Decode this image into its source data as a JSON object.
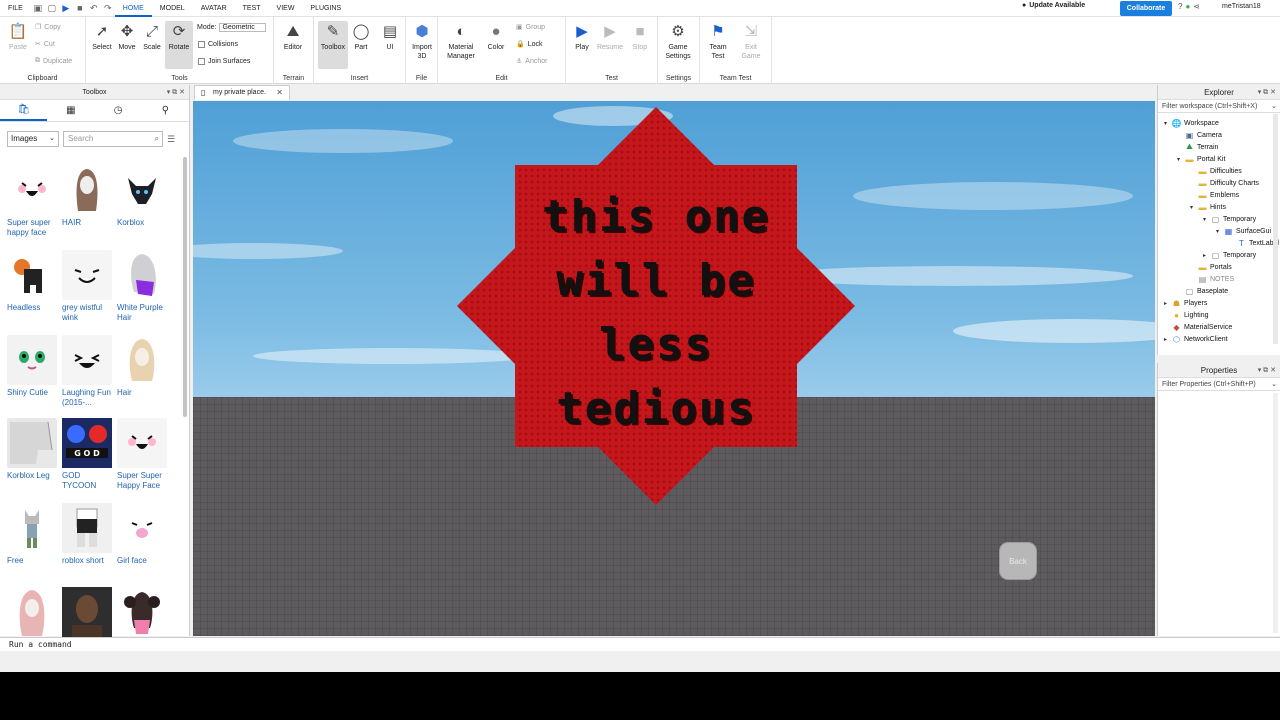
{
  "menubar": {
    "items": [
      "FILE",
      "HOME",
      "MODEL",
      "AVATAR",
      "TEST",
      "VIEW",
      "PLUGINS"
    ],
    "active": "HOME",
    "update_label": "Update Available",
    "collab_label": "Collaborate",
    "username": "meTristan18"
  },
  "ribbon": {
    "clipboard": {
      "paste": "Paste",
      "copy": "Copy",
      "cut": "Cut",
      "duplicate": "Duplicate",
      "label": "Clipboard"
    },
    "tools": {
      "select": "Select",
      "move": "Move",
      "scale": "Scale",
      "rotate": "Rotate",
      "mode_label": "Mode:",
      "mode_value": "Geometric",
      "collisions": "Collisions",
      "join_surfaces": "Join Surfaces",
      "label": "Tools"
    },
    "terrain": {
      "editor": "Editor",
      "label": "Terrain"
    },
    "insert": {
      "toolbox": "Toolbox",
      "part": "Part",
      "ui": "UI",
      "label": "Insert"
    },
    "file": {
      "import3d_l1": "Import",
      "import3d_l2": "3D",
      "label": "File"
    },
    "edit": {
      "material_l1": "Material",
      "material_l2": "Manager",
      "color": "Color",
      "group": "Group",
      "lock": "Lock",
      "anchor": "Anchor",
      "label": "Edit"
    },
    "test": {
      "play": "Play",
      "resume": "Resume",
      "stop": "Stop",
      "label": "Test"
    },
    "settings": {
      "game_l1": "Game",
      "game_l2": "Settings",
      "label": "Settings"
    },
    "teamtest": {
      "team_l1": "Team",
      "team_l2": "Test",
      "exit_l1": "Exit",
      "exit_l2": "Game",
      "label": "Team Test"
    }
  },
  "toolbox": {
    "title": "Toolbox",
    "category": "Images",
    "search_placeholder": "Search",
    "items": [
      {
        "label": "Super super happy face"
      },
      {
        "label": "HAIR"
      },
      {
        "label": "Korblox"
      },
      {
        "label": "Headless"
      },
      {
        "label": "grey wistful wink"
      },
      {
        "label": "White Purple Hair"
      },
      {
        "label": "Shiny Cutie"
      },
      {
        "label": "Laughing Fun (2015-..."
      },
      {
        "label": "Hair"
      },
      {
        "label": "Korblox Leg"
      },
      {
        "label": "GOD TYCOON"
      },
      {
        "label": "Super Super Happy Face"
      },
      {
        "label": "Free"
      },
      {
        "label": "roblox short"
      },
      {
        "label": "Girl face"
      },
      {
        "label": ""
      },
      {
        "label": ""
      },
      {
        "label": ""
      }
    ]
  },
  "document_tab": "my private place.",
  "viewport": {
    "sign_lines": [
      "this one",
      "will be",
      "less",
      "tedious"
    ],
    "sign_color": "#c4161c",
    "back_button": "Back"
  },
  "command_bar": "Run a command",
  "explorer": {
    "title": "Explorer",
    "filter": "Filter workspace (Ctrl+Shift+X)",
    "rows": [
      {
        "label": "Workspace",
        "depth": 0,
        "tw": "▾",
        "icon": "globe-icon"
      },
      {
        "label": "Camera",
        "depth": 1,
        "tw": "",
        "icon": "camera-icon"
      },
      {
        "label": "Terrain",
        "depth": 1,
        "tw": "",
        "icon": "terrain-icon"
      },
      {
        "label": "Portal Kit",
        "depth": 1,
        "tw": "▾",
        "icon": "folder-icon"
      },
      {
        "label": "Difficulties",
        "depth": 2,
        "tw": "",
        "icon": "folder-icon"
      },
      {
        "label": "Difficulty Charts",
        "depth": 2,
        "tw": "",
        "icon": "folder-icon"
      },
      {
        "label": "Emblems",
        "depth": 2,
        "tw": "",
        "icon": "folder-icon"
      },
      {
        "label": "Hints",
        "depth": 2,
        "tw": "▾",
        "icon": "folder-icon"
      },
      {
        "label": "Temporary",
        "depth": 3,
        "tw": "▾",
        "icon": "model-icon"
      },
      {
        "label": "SurfaceGui",
        "depth": 4,
        "tw": "▾",
        "icon": "gui-icon"
      },
      {
        "label": "TextLabel",
        "depth": 5,
        "tw": "",
        "icon": "text-icon"
      },
      {
        "label": "Temporary",
        "depth": 3,
        "tw": "▸",
        "icon": "model-icon"
      },
      {
        "label": "Portals",
        "depth": 2,
        "tw": "",
        "icon": "folder-icon"
      },
      {
        "label": "NOTES",
        "depth": 2,
        "tw": "",
        "icon": "script-icon"
      },
      {
        "label": "Baseplate",
        "depth": 1,
        "tw": "",
        "icon": "model-icon"
      },
      {
        "label": "Players",
        "depth": 0,
        "tw": "▸",
        "icon": "players-icon"
      },
      {
        "label": "Lighting",
        "depth": 0,
        "tw": "",
        "icon": "bulb-icon"
      },
      {
        "label": "MaterialService",
        "depth": 0,
        "tw": "",
        "icon": "material-icon"
      },
      {
        "label": "NetworkClient",
        "depth": 0,
        "tw": "▸",
        "icon": "network-icon"
      }
    ]
  },
  "properties": {
    "title": "Properties",
    "filter": "Filter Properties (Ctrl+Shift+P)"
  }
}
